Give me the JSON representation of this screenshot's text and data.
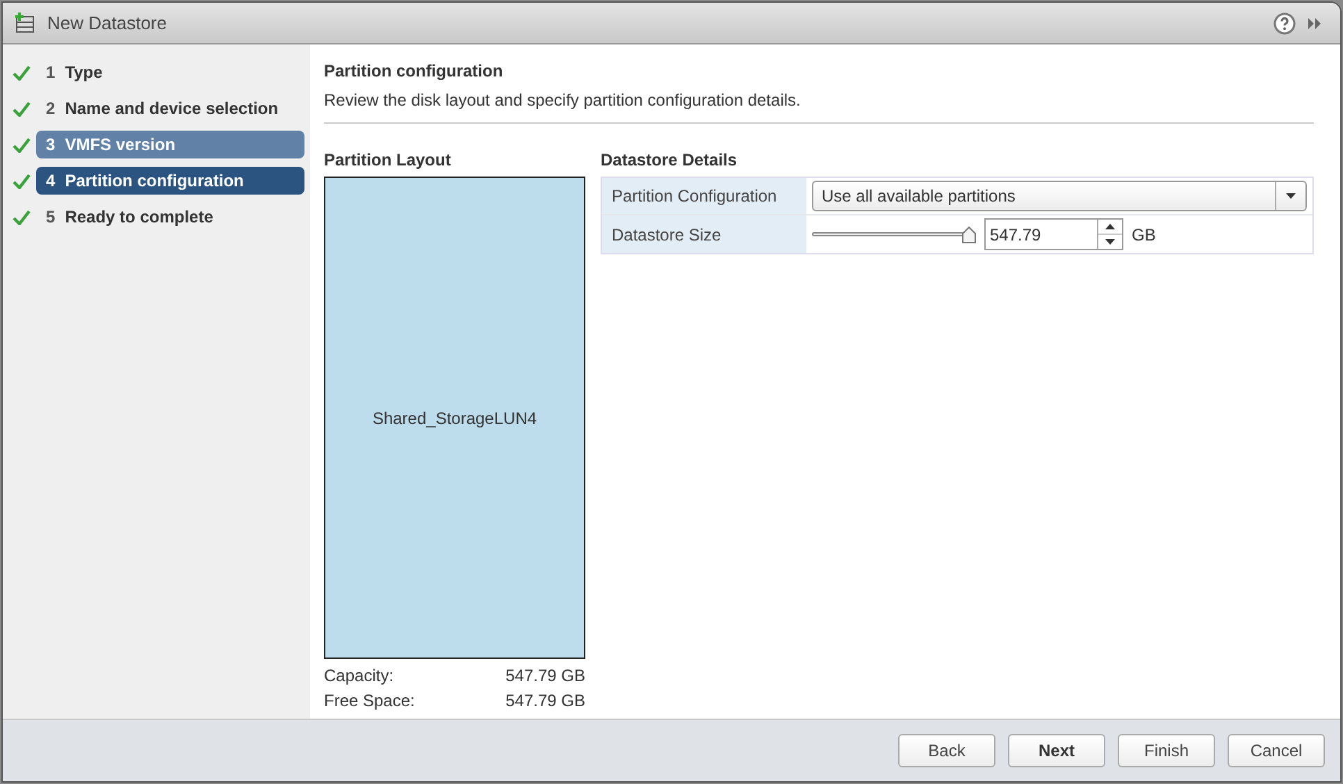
{
  "window": {
    "title": "New Datastore"
  },
  "steps": [
    {
      "number": "1",
      "label": "Type",
      "done": true,
      "selected": false,
      "hovered": false
    },
    {
      "number": "2",
      "label": "Name and device selection",
      "done": true,
      "selected": false,
      "hovered": false
    },
    {
      "number": "3",
      "label": "VMFS version",
      "done": true,
      "selected": false,
      "hovered": true
    },
    {
      "number": "4",
      "label": "Partition configuration",
      "done": true,
      "selected": true,
      "hovered": false
    },
    {
      "number": "5",
      "label": "Ready to complete",
      "done": true,
      "selected": false,
      "hovered": false
    }
  ],
  "header": {
    "title": "Partition configuration",
    "subtitle": "Review the disk layout and specify partition configuration details."
  },
  "layout": {
    "title": "Partition Layout",
    "partition": "Shared_StorageLUN4",
    "stats": [
      {
        "label": "Capacity:",
        "value": "547.79 GB"
      },
      {
        "label": "Free Space:",
        "value": "547.79 GB"
      }
    ]
  },
  "details": {
    "title": "Datastore Details",
    "partition_configuration": {
      "label": "Partition Configuration",
      "value": "Use all available partitions"
    },
    "size": {
      "label": "Datastore Size",
      "level": 1,
      "value": "547.79",
      "unit": "GB"
    }
  },
  "buttons": [
    {
      "label": "Back",
      "default": false
    },
    {
      "label": "Next",
      "default": true
    },
    {
      "label": "Finish",
      "default": false
    },
    {
      "label": "Cancel",
      "default": false
    }
  ]
}
